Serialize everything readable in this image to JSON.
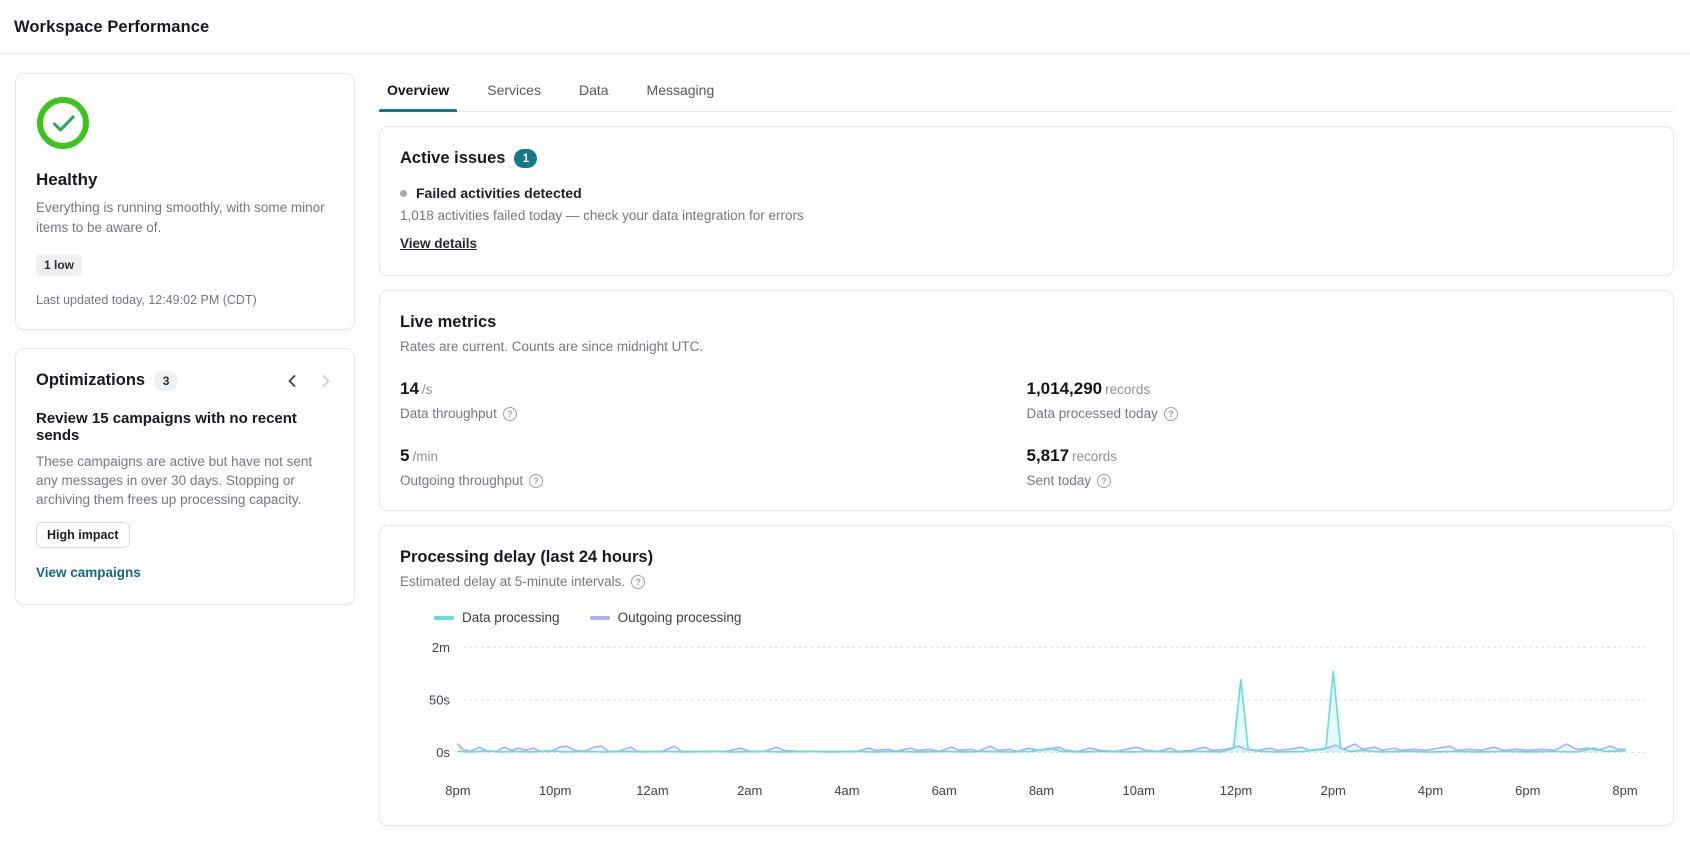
{
  "page": {
    "title": "Workspace Performance"
  },
  "colors": {
    "accent_teal": "#14798a",
    "link_teal": "#15687c",
    "health_green_ring": "#3cc41d",
    "health_green_check": "#2aa84f",
    "series_cyan": "#5fdedb",
    "series_purple": "#abadf7"
  },
  "health_card": {
    "status": "Healthy",
    "description": "Everything is running smoothly, with some minor items to be aware of.",
    "severity_badge": "1 low",
    "last_updated": "Last updated today, 12:49:02 PM (CDT)"
  },
  "optimizations_card": {
    "title": "Optimizations",
    "count": "3",
    "item_title": "Review 15 campaigns with no recent sends",
    "item_description": "These campaigns are active but have not sent any messages in over 30 days. Stopping or archiving them frees up processing capacity.",
    "impact_badge": "High impact",
    "link_label": "View campaigns"
  },
  "tabs": {
    "active": "Overview",
    "items": [
      {
        "label": "Overview"
      },
      {
        "label": "Services"
      },
      {
        "label": "Data"
      },
      {
        "label": "Messaging"
      }
    ]
  },
  "active_issues": {
    "title": "Active issues",
    "count": "1",
    "issue_title": "Failed activities detected",
    "issue_description": "1,018 activities failed today — check your data integration for errors",
    "link_label": "View details"
  },
  "live_metrics": {
    "title": "Live metrics",
    "subtitle": "Rates are current. Counts are since midnight UTC.",
    "metrics": [
      {
        "value": "14",
        "unit": "/s",
        "label": "Data throughput"
      },
      {
        "value": "1,014,290",
        "unit": "records",
        "label": "Data processed today"
      },
      {
        "value": "5",
        "unit": "/min",
        "label": "Outgoing throughput"
      },
      {
        "value": "5,817",
        "unit": "records",
        "label": "Sent today"
      }
    ]
  },
  "processing_delay": {
    "title": "Processing delay (last 24 hours)",
    "subtitle": "Estimated delay at 5-minute intervals."
  },
  "chart_data": {
    "type": "line",
    "title": "Processing delay (last 24 hours)",
    "x_axis": "time of day, 8pm through 8pm next day (24h window, 5-minute intervals)",
    "x_range_hours": [
      0,
      24
    ],
    "grid": "dotted horizontal gridlines",
    "legend_position": "top-left",
    "y_scale": "ticks equally spaced at 0s, 50s, 2m",
    "yticks": [
      {
        "label": "0s",
        "value": 0
      },
      {
        "label": "50s",
        "value": 50
      },
      {
        "label": "2m",
        "value": 120
      }
    ],
    "xticks": [
      {
        "label": "8pm",
        "hour": 0
      },
      {
        "label": "10pm",
        "hour": 2
      },
      {
        "label": "12am",
        "hour": 4
      },
      {
        "label": "2am",
        "hour": 6
      },
      {
        "label": "4am",
        "hour": 8
      },
      {
        "label": "6am",
        "hour": 10
      },
      {
        "label": "8am",
        "hour": 12
      },
      {
        "label": "10am",
        "hour": 14
      },
      {
        "label": "12pm",
        "hour": 16
      },
      {
        "label": "2pm",
        "hour": 18
      },
      {
        "label": "4pm",
        "hour": 20
      },
      {
        "label": "6pm",
        "hour": 22
      },
      {
        "label": "8pm",
        "hour": 24
      }
    ],
    "series": [
      {
        "name": "Data processing",
        "color": "#5fdedb",
        "unit": "seconds",
        "points": [
          [
            0,
            1
          ],
          [
            0.3,
            0.5
          ],
          [
            0.6,
            1.5
          ],
          [
            0.9,
            0.5
          ],
          [
            1.2,
            1
          ],
          [
            1.5,
            0.5
          ],
          [
            1.9,
            1.5
          ],
          [
            2.2,
            0.5
          ],
          [
            2.6,
            1
          ],
          [
            3.0,
            0.5
          ],
          [
            3.4,
            1
          ],
          [
            3.8,
            0.5
          ],
          [
            4.2,
            1
          ],
          [
            4.7,
            0.5
          ],
          [
            5.2,
            1
          ],
          [
            5.7,
            0.5
          ],
          [
            6.2,
            1
          ],
          [
            6.7,
            0.5
          ],
          [
            7.2,
            1
          ],
          [
            7.7,
            0.5
          ],
          [
            8.2,
            1
          ],
          [
            8.6,
            0.5
          ],
          [
            9.0,
            1
          ],
          [
            9.5,
            0.5
          ],
          [
            10.0,
            1
          ],
          [
            10.4,
            0.5
          ],
          [
            10.9,
            1
          ],
          [
            11.3,
            0.5
          ],
          [
            11.8,
            1
          ],
          [
            12.2,
            4
          ],
          [
            12.4,
            1
          ],
          [
            12.8,
            0.5
          ],
          [
            13.3,
            1
          ],
          [
            13.8,
            0.5
          ],
          [
            14.3,
            1
          ],
          [
            14.8,
            0.5
          ],
          [
            15.3,
            1
          ],
          [
            15.7,
            0.5
          ],
          [
            15.95,
            4
          ],
          [
            16.1,
            77
          ],
          [
            16.25,
            3
          ],
          [
            16.5,
            1
          ],
          [
            16.9,
            0.5
          ],
          [
            17.4,
            1
          ],
          [
            17.85,
            4
          ],
          [
            18.0,
            88
          ],
          [
            18.15,
            4
          ],
          [
            18.35,
            1
          ],
          [
            18.6,
            2
          ],
          [
            19.0,
            0.5
          ],
          [
            19.5,
            1
          ],
          [
            20.0,
            0.5
          ],
          [
            20.5,
            1
          ],
          [
            21.0,
            0.5
          ],
          [
            21.5,
            1
          ],
          [
            22.0,
            0.5
          ],
          [
            22.5,
            1
          ],
          [
            23.0,
            0.5
          ],
          [
            23.35,
            4
          ],
          [
            23.6,
            1
          ],
          [
            24,
            1.5
          ]
        ]
      },
      {
        "name": "Outgoing processing",
        "color": "#abadf7",
        "unit": "seconds",
        "points": [
          [
            0,
            8
          ],
          [
            0.1,
            3
          ],
          [
            0.25,
            1
          ],
          [
            0.45,
            5
          ],
          [
            0.6,
            1
          ],
          [
            0.8,
            1
          ],
          [
            0.95,
            5
          ],
          [
            1.1,
            2
          ],
          [
            1.25,
            4
          ],
          [
            1.4,
            2
          ],
          [
            1.55,
            4
          ],
          [
            1.7,
            1
          ],
          [
            1.9,
            1
          ],
          [
            2.1,
            5
          ],
          [
            2.25,
            6
          ],
          [
            2.4,
            2
          ],
          [
            2.6,
            1
          ],
          [
            2.8,
            5
          ],
          [
            2.95,
            6
          ],
          [
            3.1,
            1
          ],
          [
            3.3,
            1
          ],
          [
            3.55,
            5
          ],
          [
            3.7,
            1
          ],
          [
            3.9,
            1
          ],
          [
            4.2,
            1
          ],
          [
            4.45,
            6
          ],
          [
            4.6,
            1
          ],
          [
            4.9,
            1
          ],
          [
            5.2,
            1
          ],
          [
            5.5,
            1
          ],
          [
            5.8,
            4
          ],
          [
            6.0,
            1
          ],
          [
            6.3,
            1
          ],
          [
            6.55,
            5
          ],
          [
            6.7,
            2
          ],
          [
            7.0,
            1
          ],
          [
            7.3,
            1
          ],
          [
            7.6,
            1
          ],
          [
            7.9,
            1
          ],
          [
            8.2,
            1
          ],
          [
            8.45,
            4
          ],
          [
            8.6,
            2
          ],
          [
            8.85,
            3
          ],
          [
            9.0,
            1
          ],
          [
            9.3,
            4
          ],
          [
            9.45,
            2
          ],
          [
            9.7,
            3
          ],
          [
            9.9,
            1
          ],
          [
            10.15,
            5
          ],
          [
            10.3,
            2
          ],
          [
            10.55,
            3
          ],
          [
            10.7,
            1
          ],
          [
            10.95,
            6
          ],
          [
            11.1,
            2
          ],
          [
            11.35,
            3
          ],
          [
            11.5,
            1
          ],
          [
            11.75,
            4
          ],
          [
            11.9,
            2
          ],
          [
            12.15,
            3
          ],
          [
            12.35,
            5
          ],
          [
            12.5,
            2
          ],
          [
            12.75,
            1
          ],
          [
            13.0,
            4
          ],
          [
            13.2,
            2
          ],
          [
            13.5,
            1
          ],
          [
            13.75,
            3
          ],
          [
            13.95,
            5
          ],
          [
            14.15,
            2
          ],
          [
            14.4,
            1
          ],
          [
            14.65,
            4
          ],
          [
            14.8,
            1
          ],
          [
            15.1,
            2
          ],
          [
            15.35,
            5
          ],
          [
            15.5,
            2
          ],
          [
            15.8,
            3
          ],
          [
            16.05,
            6
          ],
          [
            16.2,
            3
          ],
          [
            16.45,
            2
          ],
          [
            16.7,
            4
          ],
          [
            16.85,
            2
          ],
          [
            17.1,
            3
          ],
          [
            17.35,
            5
          ],
          [
            17.5,
            2
          ],
          [
            17.8,
            3
          ],
          [
            18.05,
            7
          ],
          [
            18.2,
            3
          ],
          [
            18.45,
            8
          ],
          [
            18.6,
            3
          ],
          [
            18.85,
            5
          ],
          [
            19.0,
            2
          ],
          [
            19.25,
            4
          ],
          [
            19.4,
            2
          ],
          [
            19.65,
            3
          ],
          [
            19.9,
            2
          ],
          [
            20.15,
            4
          ],
          [
            20.4,
            6
          ],
          [
            20.55,
            2
          ],
          [
            20.8,
            3
          ],
          [
            21.05,
            2
          ],
          [
            21.3,
            5
          ],
          [
            21.5,
            2
          ],
          [
            21.75,
            3
          ],
          [
            22.0,
            2
          ],
          [
            22.3,
            3
          ],
          [
            22.55,
            2
          ],
          [
            22.8,
            8
          ],
          [
            23.0,
            3
          ],
          [
            23.25,
            4
          ],
          [
            23.45,
            2
          ],
          [
            23.7,
            6
          ],
          [
            23.85,
            3
          ],
          [
            24,
            3
          ]
        ]
      }
    ]
  }
}
